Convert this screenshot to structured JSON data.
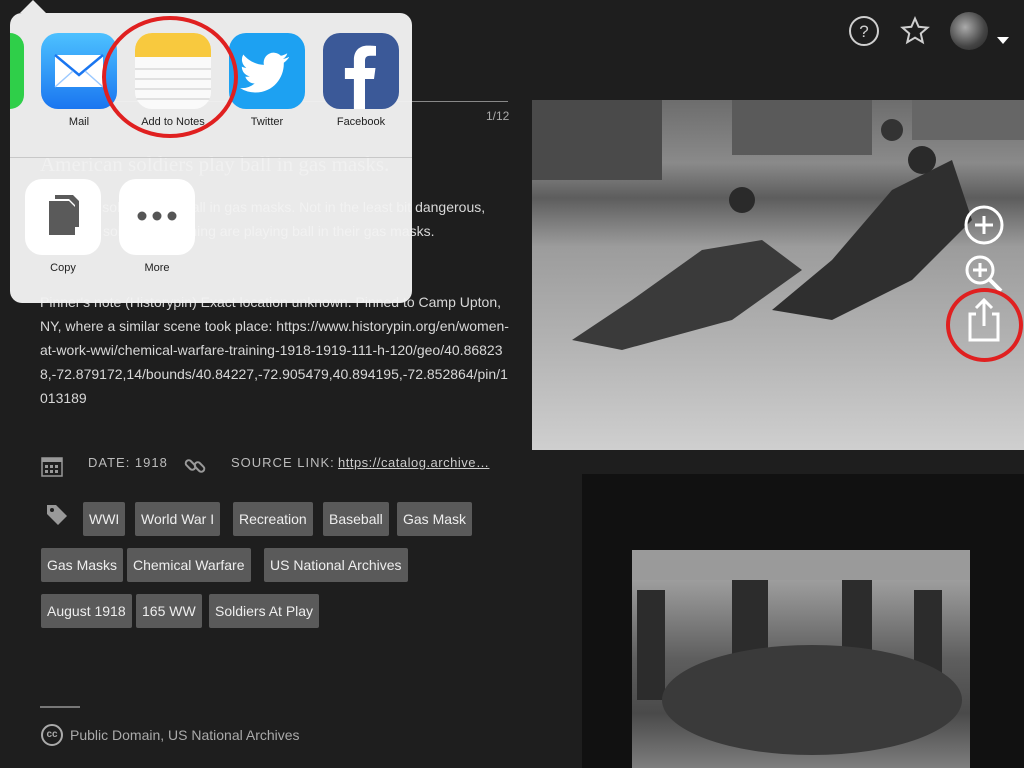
{
  "item": {
    "counter": "1/12",
    "title": "American soldiers play ball in gas masks.",
    "description": "1918: US soldiers play ball in gas masks. Not in the least bit dangerous, American soldiers in training are playing ball in their gas masks.",
    "notes": "Pinner's note (Historypin) Exact location unknown. Pinned to Camp Upton, NY, where a similar scene took place: https://www.historypin.org/en/women-at-work-wwi/chemical-warfare-training-1918-1919-111-h-120/geo/40.868238,-72.879172,14/bounds/40.84227,-72.905479,40.894195,-72.852864/pin/1013189",
    "date_label": "DATE: 1918",
    "source_label": "SOURCE LINK:",
    "source_link": "https://catalog.archive…",
    "tags": [
      "WWI",
      "World War I",
      "Recreation",
      "Baseball",
      "Gas Mask",
      "Gas Masks",
      "Chemical Warfare",
      "US National Archives",
      "August 1918",
      "165 WW",
      "Soldiers At Play"
    ],
    "license": "Public Domain, US National Archives",
    "cc_badge": "cc"
  },
  "share_sheet": {
    "apps": [
      {
        "label": "Mail",
        "icon": "mail-icon"
      },
      {
        "label": "Add to Notes",
        "icon": "notes-icon"
      },
      {
        "label": "Twitter",
        "icon": "twitter-icon"
      },
      {
        "label": "Facebook",
        "icon": "facebook-icon"
      }
    ],
    "actions": [
      {
        "label": "Copy",
        "icon": "copy-icon"
      },
      {
        "label": "More",
        "icon": "more-icon"
      }
    ]
  },
  "colors": {
    "annotation": "#e02020",
    "tag_bg": "#5a5a5a",
    "background": "#1e1e1e"
  }
}
